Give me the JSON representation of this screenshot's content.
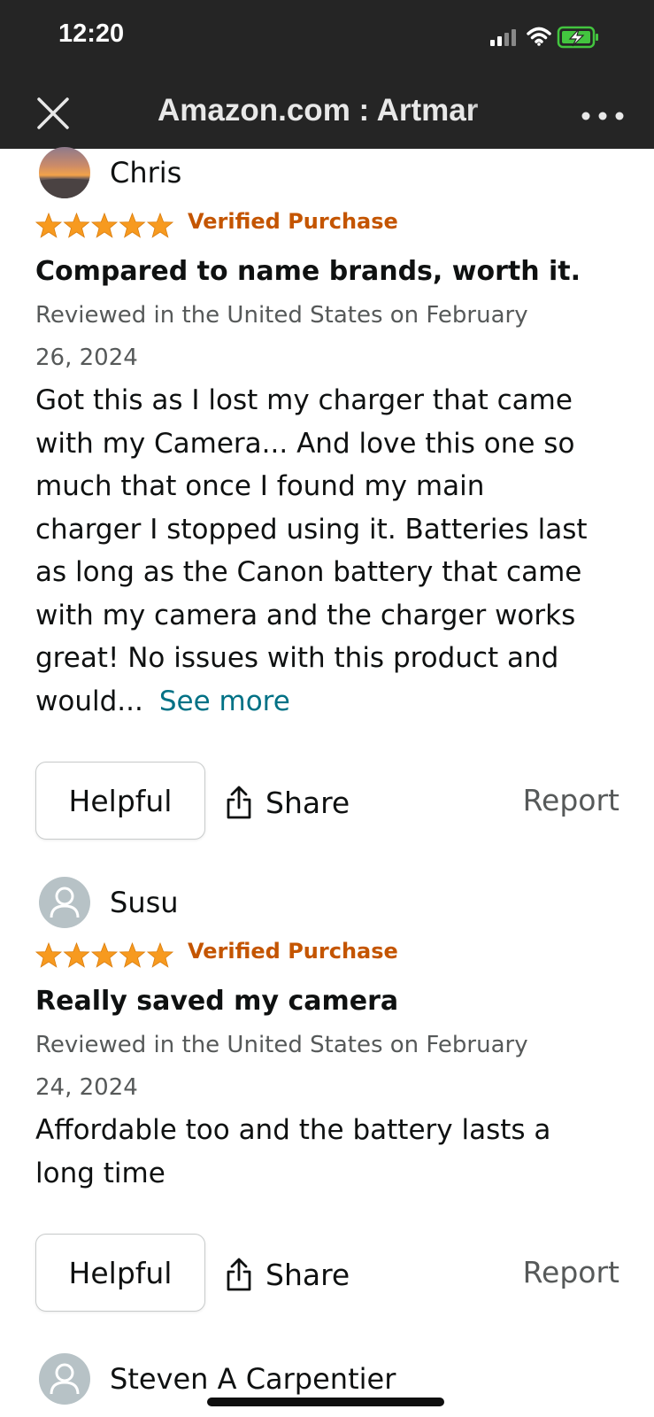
{
  "status_bar": {
    "time": "12:20"
  },
  "browser": {
    "title": "Amazon.com : Artmar"
  },
  "reviews": [
    {
      "reviewer": "Chris",
      "stars": 5,
      "verified": "Verified Purchase",
      "title": "Compared to name brands, worth it.",
      "date_line1": "Reviewed in the United States on February",
      "date_line2": "26, 2024",
      "body_lines": [
        "Got this as I lost my charger that came",
        "with my Camera... And love this one so",
        "much that once I found my main",
        "charger I stopped using it. Batteries last",
        "as long as the Canon battery that came",
        "with my camera and the charger works",
        "great! No issues with this product and",
        "would..."
      ],
      "see_more": "See more",
      "helpful": "Helpful",
      "share": "Share",
      "report": "Report"
    },
    {
      "reviewer": "Susu",
      "stars": 5,
      "verified": "Verified Purchase",
      "title": "Really saved my camera",
      "date_line1": "Reviewed in the United States on February",
      "date_line2": "24, 2024",
      "body_lines": [
        "Affordable too and the battery lasts a",
        "long time"
      ],
      "helpful": "Helpful",
      "share": "Share",
      "report": "Report"
    },
    {
      "reviewer": "Steven A Carpentier"
    }
  ],
  "colors": {
    "star": "#f79a1f",
    "verified": "#c45500",
    "link": "#007185",
    "bar": "#252525"
  }
}
